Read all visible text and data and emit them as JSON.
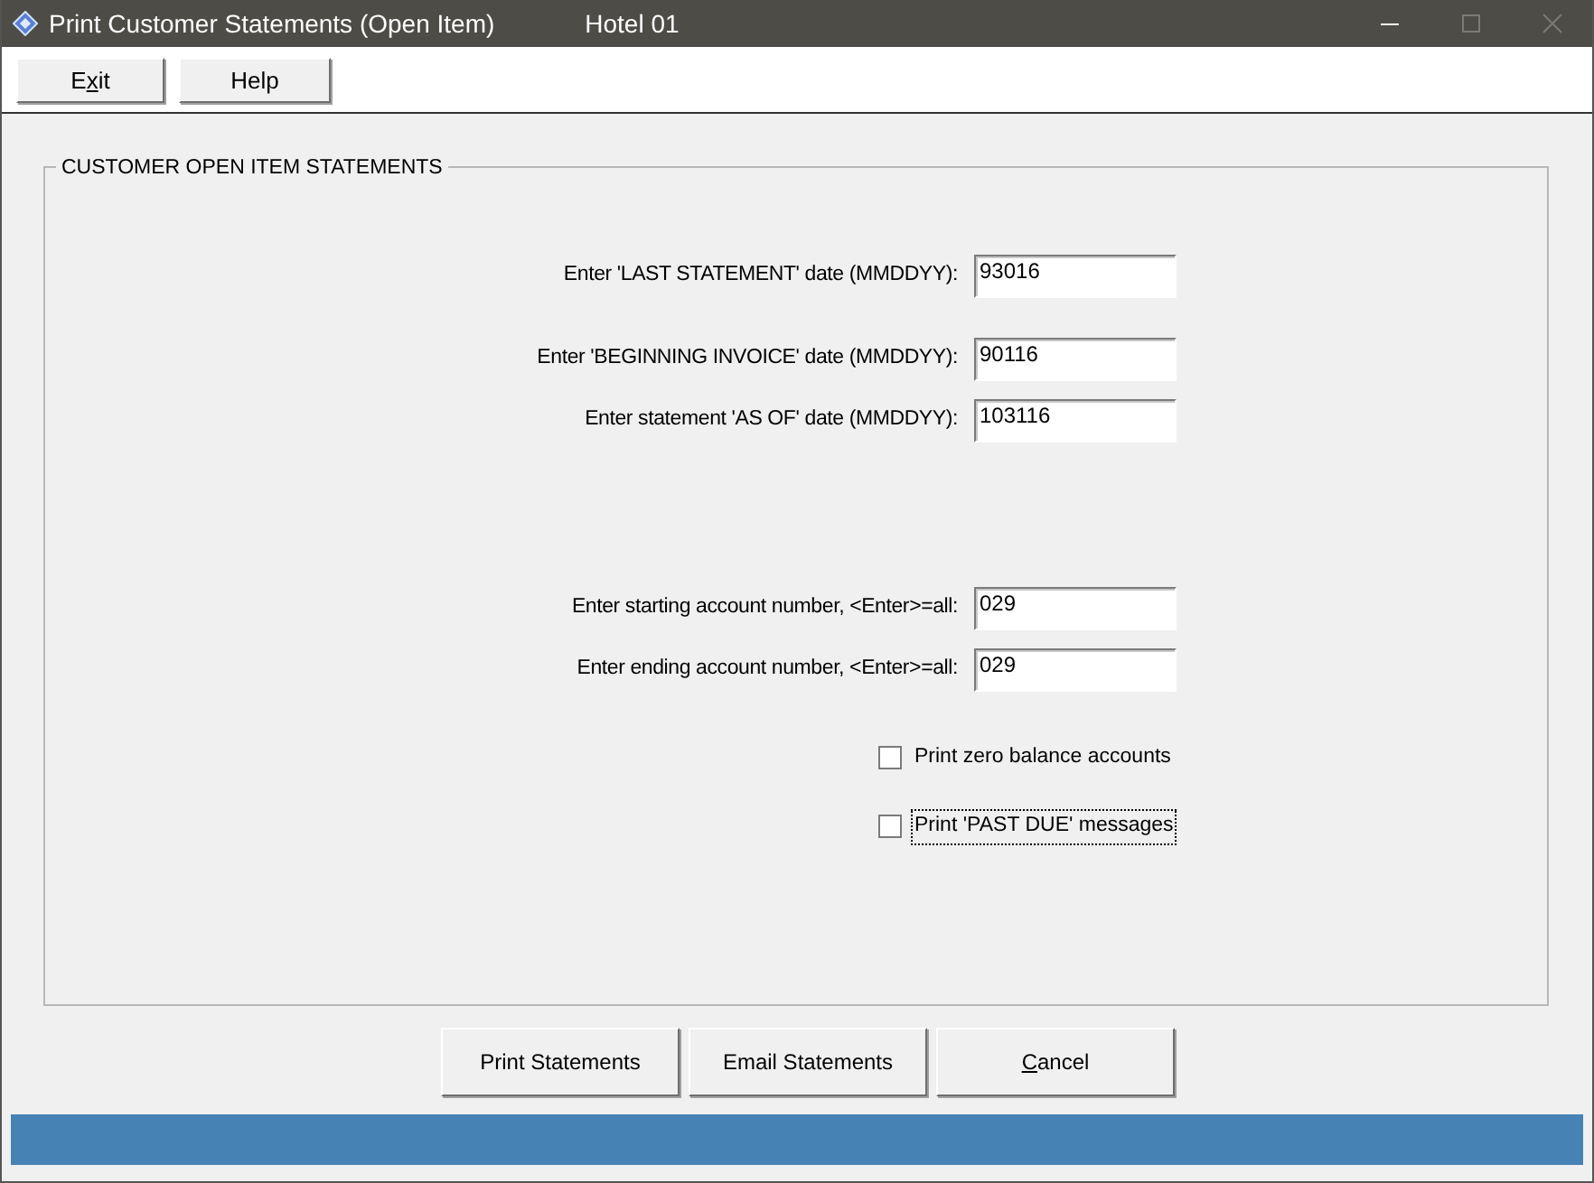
{
  "window": {
    "title": "Print Customer Statements (Open Item)",
    "company": "Hotel 01",
    "controls": [
      {
        "kind": "minimize",
        "disabled": false
      },
      {
        "kind": "maximize",
        "disabled": true
      },
      {
        "kind": "close",
        "disabled": true
      }
    ]
  },
  "toolbar": [
    {
      "before": "E",
      "access_key": "x",
      "after": "it"
    },
    {
      "before": "Help"
    }
  ],
  "group": {
    "title": "CUSTOMER OPEN ITEM STATEMENTS",
    "fields": [
      {
        "label": "Enter 'LAST STATEMENT' date (MMDDYY):",
        "value": "93016"
      },
      {
        "label": "Enter 'BEGINNING INVOICE' date (MMDDYY):",
        "value": "90116"
      },
      {
        "label": "Enter statement 'AS OF' date (MMDDYY):",
        "value": "103116"
      },
      {
        "label": "Enter starting account number, <Enter>=all:",
        "value": "029"
      },
      {
        "label": "Enter ending account number, <Enter>=all:",
        "value": "029"
      }
    ],
    "checkboxes": [
      {
        "label": "Print zero balance accounts",
        "checked": false,
        "focused": false
      },
      {
        "label": "Print 'PAST DUE' messages",
        "checked": false,
        "focused": true
      }
    ]
  },
  "buttons": [
    {
      "before": "Print Statements"
    },
    {
      "before": "Email Statements"
    },
    {
      "access_key": "C",
      "after": "ancel"
    }
  ],
  "status_bar": {
    "color": "#4682b4"
  }
}
